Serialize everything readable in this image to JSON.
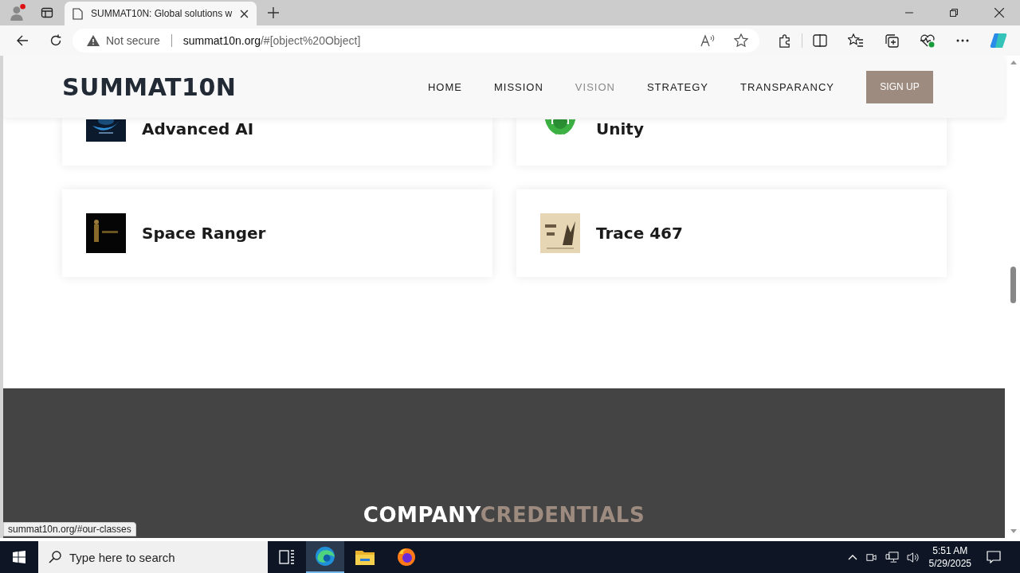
{
  "browser": {
    "tab_title": "SUMMAT10N: Global solutions w",
    "security": "Not secure",
    "url_host": "summat10n.org",
    "url_path": "/#[object%20Object]"
  },
  "site": {
    "logo": "SUMMAT10N",
    "nav": [
      {
        "label": "HOME",
        "selected": false
      },
      {
        "label": "MISSION",
        "selected": false
      },
      {
        "label": "VISION",
        "selected": true
      },
      {
        "label": "STRATEGY",
        "selected": false
      },
      {
        "label": "TRANSPARANCY",
        "selected": false
      }
    ],
    "signup": "SIGN UP"
  },
  "cards": [
    {
      "title": "Advanced AI"
    },
    {
      "title": "Unity"
    },
    {
      "title": "Space Ranger"
    },
    {
      "title": "Trace 467"
    }
  ],
  "footer": {
    "heading_part_1": "COMPANY",
    "heading_part_2": "CREDENTIALS"
  },
  "status_link": "summat10n.org/#our-classes",
  "taskbar": {
    "search_placeholder": "Type here to search",
    "time": "5:51 AM",
    "date": "5/29/2025"
  }
}
